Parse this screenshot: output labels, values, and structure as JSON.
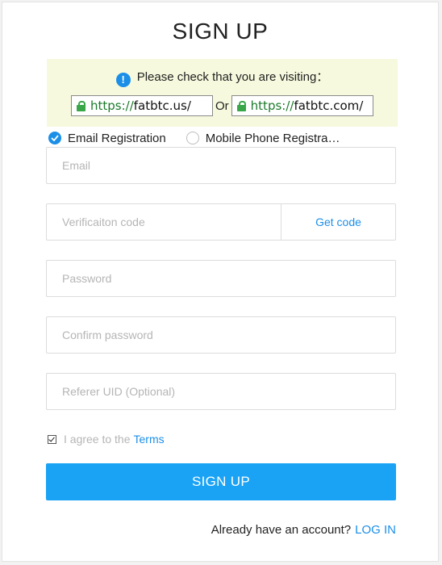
{
  "title": "SIGN UP",
  "notice": {
    "icon": "info-icon",
    "text": "Please check that you are visiting：",
    "url1_scheme": "https://",
    "url1_host": "fatbtc.us/",
    "or_text": "Or",
    "url2_scheme": "https://",
    "url2_host": "fatbtc.com/"
  },
  "registration_type": {
    "email_label": "Email Registration",
    "phone_label": "Mobile Phone Registra…",
    "selected": "email"
  },
  "fields": {
    "email_placeholder": "Email",
    "code_placeholder": "Verificaiton code",
    "get_code_label": "Get code",
    "password_placeholder": "Password",
    "confirm_placeholder": "Confirm password",
    "referer_placeholder": "Referer UID (Optional)"
  },
  "agree": {
    "checked": true,
    "text": "I agree to the",
    "terms_label": "Terms"
  },
  "signup_button": "SIGN UP",
  "login": {
    "prompt": "Already have an account?",
    "link_label": "LOG IN"
  },
  "colors": {
    "accent": "#1b8fe8",
    "button": "#1aa3f5",
    "notice_bg": "#f6f9dd",
    "secure_green": "#1a7a2a"
  }
}
